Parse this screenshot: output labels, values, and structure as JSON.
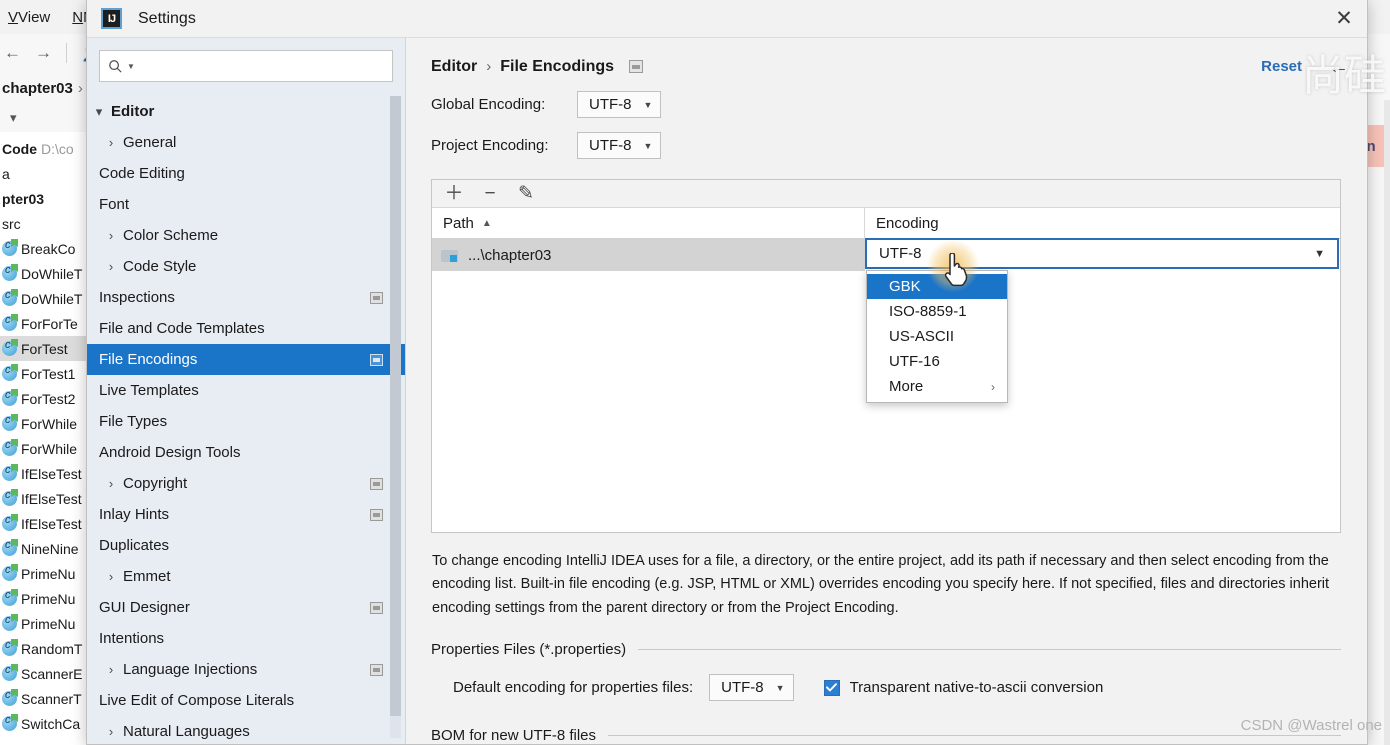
{
  "background_ide": {
    "menubar": [
      {
        "label": "View",
        "mnemonic": "V"
      },
      {
        "label": "Nav",
        "mnemonic": "N"
      }
    ],
    "breadcrumb": "chapter03",
    "project_root": "Code",
    "project_path": "D:\\co",
    "tree_items": [
      {
        "label": "a",
        "type": "folder",
        "bold": false
      },
      {
        "label": "pter03",
        "type": "folder",
        "bold": true
      },
      {
        "label": "src",
        "type": "folder",
        "bold": false
      },
      {
        "label": "BreakCo",
        "type": "java-class",
        "bold": false
      },
      {
        "label": "DoWhileT",
        "type": "java-class",
        "bold": false
      },
      {
        "label": "DoWhileT",
        "type": "java-class",
        "bold": false
      },
      {
        "label": "ForForTe",
        "type": "java-class",
        "bold": false
      },
      {
        "label": "ForTest",
        "type": "java-class",
        "bold": false,
        "selected": true
      },
      {
        "label": "ForTest1",
        "type": "java-class",
        "bold": false
      },
      {
        "label": "ForTest2",
        "type": "java-class",
        "bold": false
      },
      {
        "label": "ForWhile",
        "type": "java-class",
        "bold": false
      },
      {
        "label": "ForWhile",
        "type": "java-class",
        "bold": false
      },
      {
        "label": "IfElseTest",
        "type": "java-class",
        "bold": false
      },
      {
        "label": "IfElseTest",
        "type": "java-class",
        "bold": false
      },
      {
        "label": "IfElseTest",
        "type": "java-class",
        "bold": false
      },
      {
        "label": "NineNine",
        "type": "java-class",
        "bold": false
      },
      {
        "label": "PrimeNu",
        "type": "java-class",
        "bold": false
      },
      {
        "label": "PrimeNu",
        "type": "java-class",
        "bold": false
      },
      {
        "label": "PrimeNu",
        "type": "java-class",
        "bold": false
      },
      {
        "label": "RandomT",
        "type": "java-class",
        "bold": false
      },
      {
        "label": "ScannerE",
        "type": "java-class",
        "bold": false
      },
      {
        "label": "ScannerT",
        "type": "java-class",
        "bold": false
      },
      {
        "label": "SwitchCa",
        "type": "java-class",
        "bold": false
      }
    ],
    "right_tab_label": "in"
  },
  "dialog": {
    "title": "Settings",
    "logo_text": "IJ",
    "close_icon": "close-icon"
  },
  "search": {
    "value": "",
    "placeholder": ""
  },
  "sidebar": {
    "items": [
      {
        "label": "Editor",
        "level": 0,
        "chevron": "down",
        "bold": true,
        "badge": false
      },
      {
        "label": "General",
        "level": 1,
        "chevron": "right",
        "bold": false,
        "badge": false
      },
      {
        "label": "Code Editing",
        "level": 1,
        "chevron": "none",
        "bold": false,
        "badge": false
      },
      {
        "label": "Font",
        "level": 1,
        "chevron": "none",
        "bold": false,
        "badge": false
      },
      {
        "label": "Color Scheme",
        "level": 1,
        "chevron": "right",
        "bold": false,
        "badge": false
      },
      {
        "label": "Code Style",
        "level": 1,
        "chevron": "right",
        "bold": false,
        "badge": false
      },
      {
        "label": "Inspections",
        "level": 1,
        "chevron": "none",
        "bold": false,
        "badge": true
      },
      {
        "label": "File and Code Templates",
        "level": 1,
        "chevron": "none",
        "bold": false,
        "badge": false
      },
      {
        "label": "File Encodings",
        "level": 1,
        "chevron": "none",
        "bold": false,
        "badge": true,
        "selected": true
      },
      {
        "label": "Live Templates",
        "level": 1,
        "chevron": "none",
        "bold": false,
        "badge": false
      },
      {
        "label": "File Types",
        "level": 1,
        "chevron": "none",
        "bold": false,
        "badge": false
      },
      {
        "label": "Android Design Tools",
        "level": 1,
        "chevron": "none",
        "bold": false,
        "badge": false
      },
      {
        "label": "Copyright",
        "level": 1,
        "chevron": "right",
        "bold": false,
        "badge": true
      },
      {
        "label": "Inlay Hints",
        "level": 1,
        "chevron": "none",
        "bold": false,
        "badge": true
      },
      {
        "label": "Duplicates",
        "level": 1,
        "chevron": "none",
        "bold": false,
        "badge": false
      },
      {
        "label": "Emmet",
        "level": 1,
        "chevron": "right",
        "bold": false,
        "badge": false
      },
      {
        "label": "GUI Designer",
        "level": 1,
        "chevron": "none",
        "bold": false,
        "badge": true
      },
      {
        "label": "Intentions",
        "level": 1,
        "chevron": "none",
        "bold": false,
        "badge": false
      },
      {
        "label": "Language Injections",
        "level": 1,
        "chevron": "right",
        "bold": false,
        "badge": true
      },
      {
        "label": "Live Edit of Compose Literals",
        "level": 1,
        "chevron": "none",
        "bold": false,
        "badge": false
      },
      {
        "label": "Natural Languages",
        "level": 1,
        "chevron": "right",
        "bold": false,
        "badge": false
      }
    ]
  },
  "main": {
    "breadcrumb": {
      "parent": "Editor",
      "separator": "›",
      "current": "File Encodings"
    },
    "reset_label": "Reset",
    "back_icon": "←",
    "global_encoding": {
      "label": "Global Encoding:",
      "value": "UTF-8"
    },
    "project_encoding": {
      "label": "Project Encoding:",
      "value": "UTF-8"
    },
    "table": {
      "toolbar": [
        {
          "icon": "plus-icon",
          "glyph": "＋"
        },
        {
          "icon": "minus-icon",
          "glyph": "−"
        },
        {
          "icon": "pencil-icon",
          "glyph": "✎"
        }
      ],
      "columns": [
        {
          "label": "Path",
          "sorted": true,
          "sort_dir": "asc"
        },
        {
          "label": "Encoding",
          "sorted": false
        }
      ],
      "rows": [
        {
          "path": "...\\chapter03",
          "encoding": "UTF-8",
          "selected": true
        }
      ]
    },
    "dropdown": {
      "open": true,
      "options": [
        {
          "label": "GBK",
          "highlighted": true,
          "submenu": false
        },
        {
          "label": "ISO-8859-1",
          "highlighted": false,
          "submenu": false
        },
        {
          "label": "US-ASCII",
          "highlighted": false,
          "submenu": false
        },
        {
          "label": "UTF-16",
          "highlighted": false,
          "submenu": false
        },
        {
          "label": "More",
          "highlighted": false,
          "submenu": true,
          "arrow": "›"
        }
      ]
    },
    "help_text": "To change encoding IntelliJ IDEA uses for a file, a directory, or the entire project, add its path if necessary and then select encoding from the encoding list. Built-in file encoding (e.g. JSP, HTML or XML) overrides encoding you specify here. If not specified, files and directories inherit encoding settings from the parent directory or from the Project Encoding.",
    "properties_group": {
      "title": "Properties Files (*.properties)",
      "default_encoding_label": "Default encoding for properties files:",
      "default_encoding_value": "UTF-8",
      "checkbox_label": "Transparent native-to-ascii conversion",
      "checkbox_checked": true
    },
    "bom_group": {
      "title": "BOM for new UTF-8 files"
    }
  },
  "watermarks": {
    "chinese": "尚硅",
    "csdn": "CSDN @Wastrel one"
  },
  "colors": {
    "accent_blue": "#1a74c8",
    "link_blue": "#2a6db5",
    "sidebar_bg": "#e8ecf3",
    "dialog_bg": "#f2f2f2",
    "row_selected": "#d3d3d3",
    "checkbox_blue": "#2a7fd4"
  }
}
